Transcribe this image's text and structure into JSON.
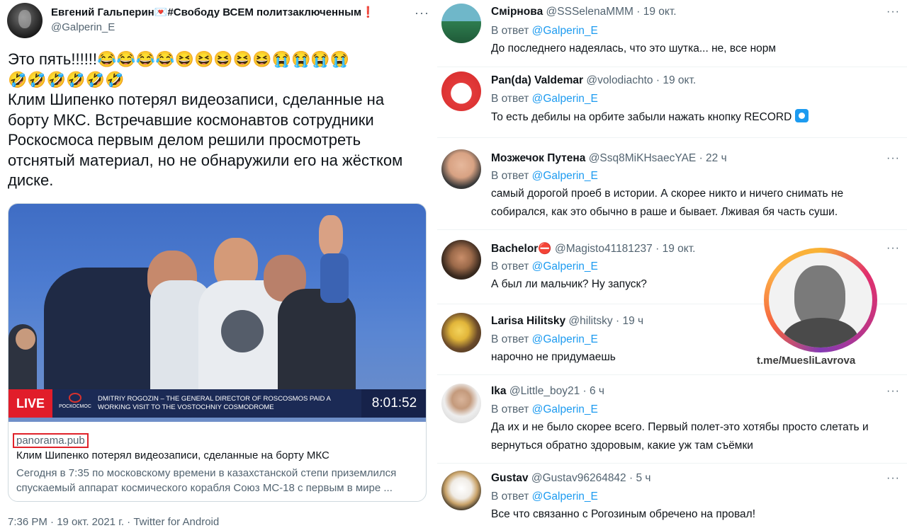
{
  "main_tweet": {
    "author_name": "Евгений Гальперин",
    "author_name_suffix": "#Свободу ВСЕМ политзаключенным",
    "handle": "@Galperin_E",
    "more_icon": "more-dots-icon",
    "text_intro": "Это пять!!!!!!",
    "emoji_line1": "😂😂😂😂😆😆😆😆😆😭😭😭😭",
    "emoji_line2": "🤣🤣🤣🤣🤣🤣",
    "text_body": "Клим Шипенко потерял видеозаписи, сделанные на борту МКС. Встречавшие космонавтов сотрудники Роскосмоса первым делом решили просмотреть отснятый материал, но не обнаружили его на жёстком диске.",
    "card": {
      "live_label": "LIVE",
      "logo_label": "РОСКОСМОС",
      "broadcast_caption": "DMITRIY ROGOZIN – THE GENERAL DIRECTOR OF ROSCOSMOS PAID A WORKING VISIT TO THE VOSTOCHNIY COSMODROME",
      "broadcast_time": "8:01:52",
      "domain": "panorama.pub",
      "title": "Клим Шипенко потерял видеозаписи, сделанные на борту МКС",
      "description": "Сегодня в 7:35 по московскому времени в казахстанской степи приземлился спускаемый аппарат космического корабля Союз МС-18 с первым в мире ..."
    },
    "meta": "7:36 PM · 19 окт. 2021 г. · Twitter for Android"
  },
  "replies": [
    {
      "name": "Смірнова",
      "handle": "@SSSelenaMMM",
      "time": "19 окт.",
      "replying_prefix": "В ответ",
      "mention": "@Galperin_E",
      "text": "До последнего надеялась, что это шутка... не, все норм"
    },
    {
      "name": "Pan(da) Valdemar",
      "handle": "@volodiachto",
      "time": "19 окт.",
      "replying_prefix": "В ответ",
      "mention": "@Galperin_E",
      "text": "То есть дебилы на орбите забыли нажать кнопку RECORD"
    },
    {
      "name": "Мозжечок Путена",
      "handle": "@Ssq8MiKHsaecYAE",
      "time": "22 ч",
      "replying_prefix": "В ответ",
      "mention": "@Galperin_E",
      "text": "самый дорогой проеб в истории. А скорее никто и ничего снимать не собирался, как это обычно в раше и бывает. Лживая бя часть суши."
    },
    {
      "name": "Bachelor",
      "handle": "@Magisto41181237",
      "time": "19 окт.",
      "replying_prefix": "В ответ",
      "mention": "@Galperin_E",
      "text": "А был ли мальчик? Ну запуск?"
    },
    {
      "name": "Larisa Hilitsky",
      "handle": "@hilitsky",
      "time": "19 ч",
      "replying_prefix": "В ответ",
      "mention": "@Galperin_E",
      "text": "нарочно не придумаешь"
    },
    {
      "name": "Ika",
      "handle": "@Little_boy21",
      "time": "6 ч",
      "replying_prefix": "В ответ",
      "mention": "@Galperin_E",
      "text": "Да их и не было скорее всего. Первый полет-это хотябы просто слетать и вернуться обратно здоровым, какие уж там съёмки"
    },
    {
      "name": "Gustav",
      "handle": "@Gustav96264842",
      "time": "5 ч",
      "replying_prefix": "В ответ",
      "mention": "@Galperin_E",
      "text": "Все что связанно с Рогозиным обречено на провал!"
    }
  ],
  "watermark": {
    "text": "t.me/MuesliLavrova"
  },
  "colors": {
    "link": "#1d9bf0",
    "secondary_text": "#536471",
    "live_red": "#e11d2a"
  }
}
